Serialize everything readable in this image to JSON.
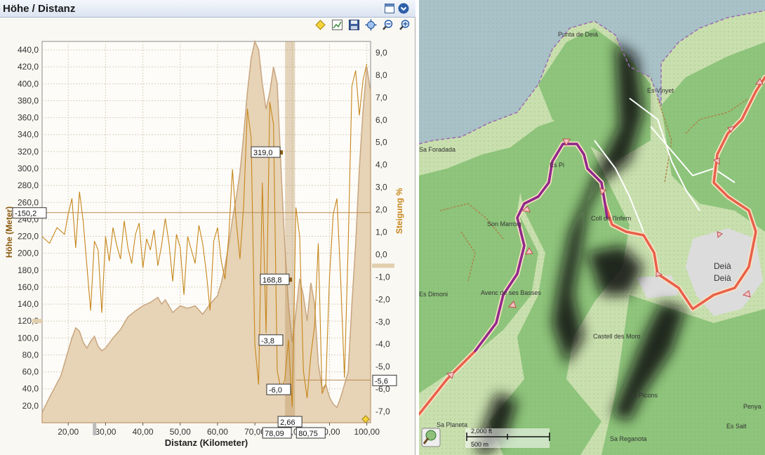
{
  "window": {
    "title": "Höhe / Distanz"
  },
  "toolbar": {
    "icons": [
      "waypoint-icon",
      "chart-settings-icon",
      "save-icon",
      "zoom-extent-icon",
      "zoom-out-icon",
      "zoom-in-icon"
    ]
  },
  "colors": {
    "elevation_fill": "#e7d3b6",
    "elevation_stroke": "#c8a57e",
    "slope_line": "#c6861b",
    "marker": "#8a5a0e",
    "map_green": "#8ec47b",
    "map_water": "#a9c1c8",
    "route": "#e8604a",
    "route_purple": "#8e2a8c"
  },
  "chart_data": {
    "type": "line",
    "xlabel": "Distanz (Kilometer)",
    "ylabel": "Höhe (Meter)",
    "y2label": "Steigung %",
    "xlim": [
      13,
      101
    ],
    "ylim": [
      0,
      450
    ],
    "y2lim": [
      -7.5,
      9.5
    ],
    "x_ticks": [
      "20,00",
      "30,00",
      "40,00",
      "50,00",
      "60,00",
      "70,00",
      "80,00",
      "90,00",
      "100,00"
    ],
    "y_ticks": [
      "20,0",
      "40,0",
      "60,0",
      "80,0",
      "100,0",
      "120,0",
      "140,0",
      "160,0",
      "180,0",
      "200,0",
      "220,0",
      "240,0",
      "260,0",
      "280,0",
      "300,0",
      "320,0",
      "340,0",
      "360,0",
      "380,0",
      "400,0",
      "420,0",
      "440,0"
    ],
    "y2_ticks": [
      "-7,0",
      "-6,0",
      "-5,0",
      "-4,0",
      "-3,0",
      "-2,0",
      "-1,0",
      "0,0",
      "1,0",
      "2,0",
      "3,0",
      "4,0",
      "5,0",
      "6,0",
      "7,0",
      "8,0",
      "9,0"
    ],
    "series": [
      {
        "name": "Höhe",
        "x": [
          13,
          15,
          18,
          20,
          21,
          22,
          23,
          24,
          25,
          26,
          27,
          28,
          29,
          30,
          32,
          34,
          36,
          38,
          40,
          42,
          44,
          45,
          46,
          48,
          50,
          52,
          54,
          56,
          58,
          60,
          61,
          62,
          63,
          64,
          65,
          66,
          67,
          68,
          69,
          70,
          71,
          72,
          73,
          74,
          75,
          76,
          77,
          78,
          79,
          80,
          81,
          82,
          83,
          84,
          85,
          86,
          87,
          88,
          89,
          90,
          91,
          92,
          93,
          94,
          95,
          96,
          97,
          98,
          99,
          100,
          101
        ],
        "y": [
          12,
          30,
          55,
          85,
          100,
          112,
          108,
          95,
          88,
          96,
          102,
          90,
          85,
          88,
          100,
          110,
          125,
          132,
          138,
          142,
          148,
          140,
          145,
          130,
          138,
          135,
          138,
          128,
          140,
          150,
          165,
          185,
          210,
          240,
          265,
          295,
          340,
          390,
          430,
          460,
          440,
          400,
          370,
          390,
          420,
          400,
          300,
          210,
          140,
          95,
          130,
          170,
          150,
          120,
          165,
          140,
          70,
          40,
          45,
          30,
          22,
          18,
          30,
          45,
          60,
          140,
          210,
          300,
          370,
          420,
          390
        ]
      },
      {
        "name": "Steigung %",
        "x": [
          13,
          15,
          17,
          19,
          20,
          21,
          22,
          23,
          24,
          25,
          26,
          27,
          28,
          29,
          30,
          31,
          32,
          33,
          34,
          35,
          36,
          37,
          38,
          39,
          40,
          41,
          42,
          43,
          44,
          45,
          46,
          47,
          48,
          49,
          50,
          51,
          52,
          53,
          54,
          55,
          56,
          57,
          58,
          59,
          60,
          61,
          62,
          63,
          64,
          65,
          66,
          67,
          68,
          69,
          70,
          71,
          72,
          73,
          74,
          75,
          76,
          77,
          78,
          79,
          80,
          81,
          82,
          83,
          84,
          85,
          86,
          87,
          88,
          89,
          90,
          91,
          92,
          93,
          94,
          95,
          96,
          97,
          98,
          99,
          100
        ],
        "y": [
          0.8,
          0.5,
          1.2,
          0.9,
          1.8,
          2.5,
          0.3,
          2.8,
          1.5,
          -0.5,
          -2.5,
          0.6,
          0.2,
          -2.6,
          0.8,
          -0.3,
          1.2,
          0.4,
          -0.2,
          1.5,
          0.3,
          -0.4,
          0.9,
          1.4,
          -0.6,
          0.7,
          0.2,
          1.1,
          -0.5,
          0.4,
          1.6,
          0.5,
          -1.2,
          0.9,
          0.3,
          -1.8,
          0.8,
          0.2,
          -0.4,
          1.3,
          0.5,
          -0.8,
          -2.5,
          0.6,
          1.2,
          -0.3,
          -1.1,
          0.8,
          3.8,
          1.5,
          -0.2,
          2.2,
          6.5,
          5.2,
          -4.0,
          -5.8,
          3.2,
          -3.5,
          6.8,
          5.8,
          -5.2,
          -6.0,
          -5.6,
          -3.8,
          -6.8,
          2.1,
          0.8,
          -5.2,
          -6.4,
          -4.5,
          -3.2,
          0.5,
          -6.2,
          -5.8,
          -1.0,
          1.8,
          2.5,
          -1.2,
          -5.5,
          0.4,
          7.5,
          8.2,
          6.2,
          7.8,
          8.5
        ]
      }
    ],
    "markers": {
      "elevation": [
        "319,0",
        "168,8"
      ],
      "slope": [
        "-3,8",
        "-6,0"
      ],
      "left_readout": "-150,2",
      "right_readout": "-5,6",
      "x_readouts": [
        "78,09",
        "2,66",
        "80,75"
      ]
    },
    "grid": true,
    "legend": "none"
  },
  "map": {
    "labels": [
      "Punta de Deià",
      "Es Vinyet",
      "Es Pi",
      "Sa Foradada",
      "Son Marroig",
      "Coll de l'Infern",
      "Deià",
      "Deià",
      "Deià",
      "Deia",
      "Avenc de ses Basses",
      "Es Dimoni",
      "Castell des Moro",
      "Es Picons",
      "Sa Planeta",
      "Sa Reganota",
      "Es Salt",
      "Penya"
    ],
    "scale_ft": "2,000 ft",
    "scale_m": "500 m"
  }
}
